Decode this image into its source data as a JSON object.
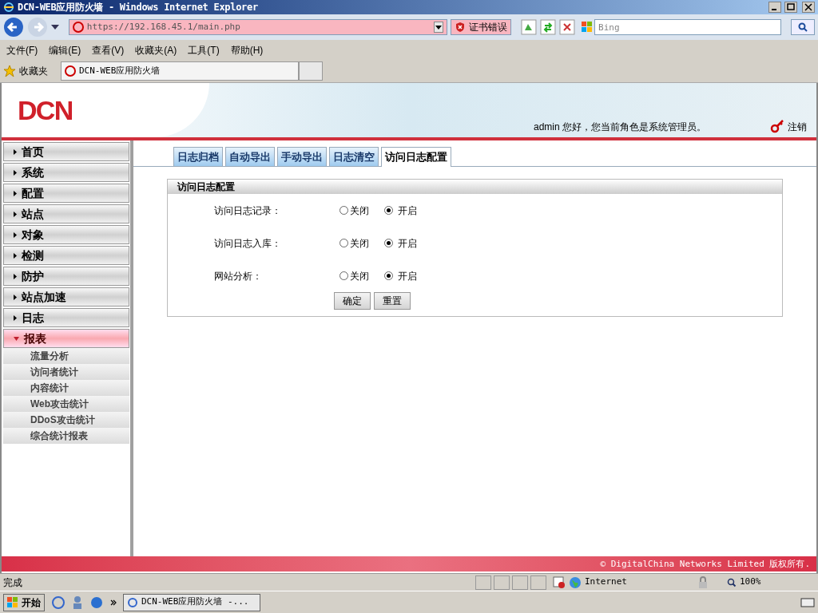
{
  "window": {
    "title": "DCN-WEB应用防火墙 - Windows Internet Explorer"
  },
  "toolbar": {
    "address": "https://192.168.45.1/main.php",
    "cert_error": "证书错误",
    "search_placeholder": "Bing"
  },
  "menu": [
    "文件(F)",
    "编辑(E)",
    "查看(V)",
    "收藏夹(A)",
    "工具(T)",
    "帮助(H)"
  ],
  "favorites": {
    "label": "收藏夹",
    "tab_title": "DCN-WEB应用防火墙"
  },
  "header": {
    "logo": "DCN",
    "greeting": "admin 您好，您当前角色是系统管理员。",
    "logout": "注销"
  },
  "sidebar": {
    "items": [
      {
        "label": "首页",
        "expanded": false
      },
      {
        "label": "系统",
        "expanded": false
      },
      {
        "label": "配置",
        "expanded": false
      },
      {
        "label": "站点",
        "expanded": false
      },
      {
        "label": "对象",
        "expanded": false
      },
      {
        "label": "检测",
        "expanded": false
      },
      {
        "label": "防护",
        "expanded": false
      },
      {
        "label": "站点加速",
        "expanded": false
      },
      {
        "label": "日志",
        "expanded": false
      },
      {
        "label": "报表",
        "expanded": true,
        "children": [
          {
            "label": "流量分析"
          },
          {
            "label": "访问者统计"
          },
          {
            "label": "内容统计"
          },
          {
            "label": "Web攻击统计"
          },
          {
            "label": "DDoS攻击统计"
          },
          {
            "label": "综合统计报表"
          }
        ]
      }
    ]
  },
  "tabs": [
    {
      "label": "日志归档",
      "selected": false
    },
    {
      "label": "自动导出",
      "selected": false
    },
    {
      "label": "手动导出",
      "selected": false
    },
    {
      "label": "日志清空",
      "selected": false
    },
    {
      "label": "访问日志配置",
      "selected": true
    }
  ],
  "panel": {
    "title": "访问日志配置",
    "rows": [
      {
        "label": "访问日志记录：",
        "options": [
          {
            "label": "关闭",
            "selected": false
          },
          {
            "label": "开启",
            "selected": true
          }
        ]
      },
      {
        "label": "访问日志入库：",
        "options": [
          {
            "label": "关闭",
            "selected": false
          },
          {
            "label": "开启",
            "selected": true
          }
        ]
      },
      {
        "label": "网站分析：",
        "options": [
          {
            "label": "关闭",
            "selected": false
          },
          {
            "label": "开启",
            "selected": true
          }
        ]
      }
    ],
    "buttons": [
      "确定",
      "重置"
    ]
  },
  "footer": "© DigitalChina Networks Limited 版权所有.",
  "status_bar": {
    "text": "完成",
    "zone": "Internet",
    "zoom": "100%"
  },
  "taskbar": {
    "start": "开始",
    "window": "DCN-WEB应用防火墙 -..."
  }
}
